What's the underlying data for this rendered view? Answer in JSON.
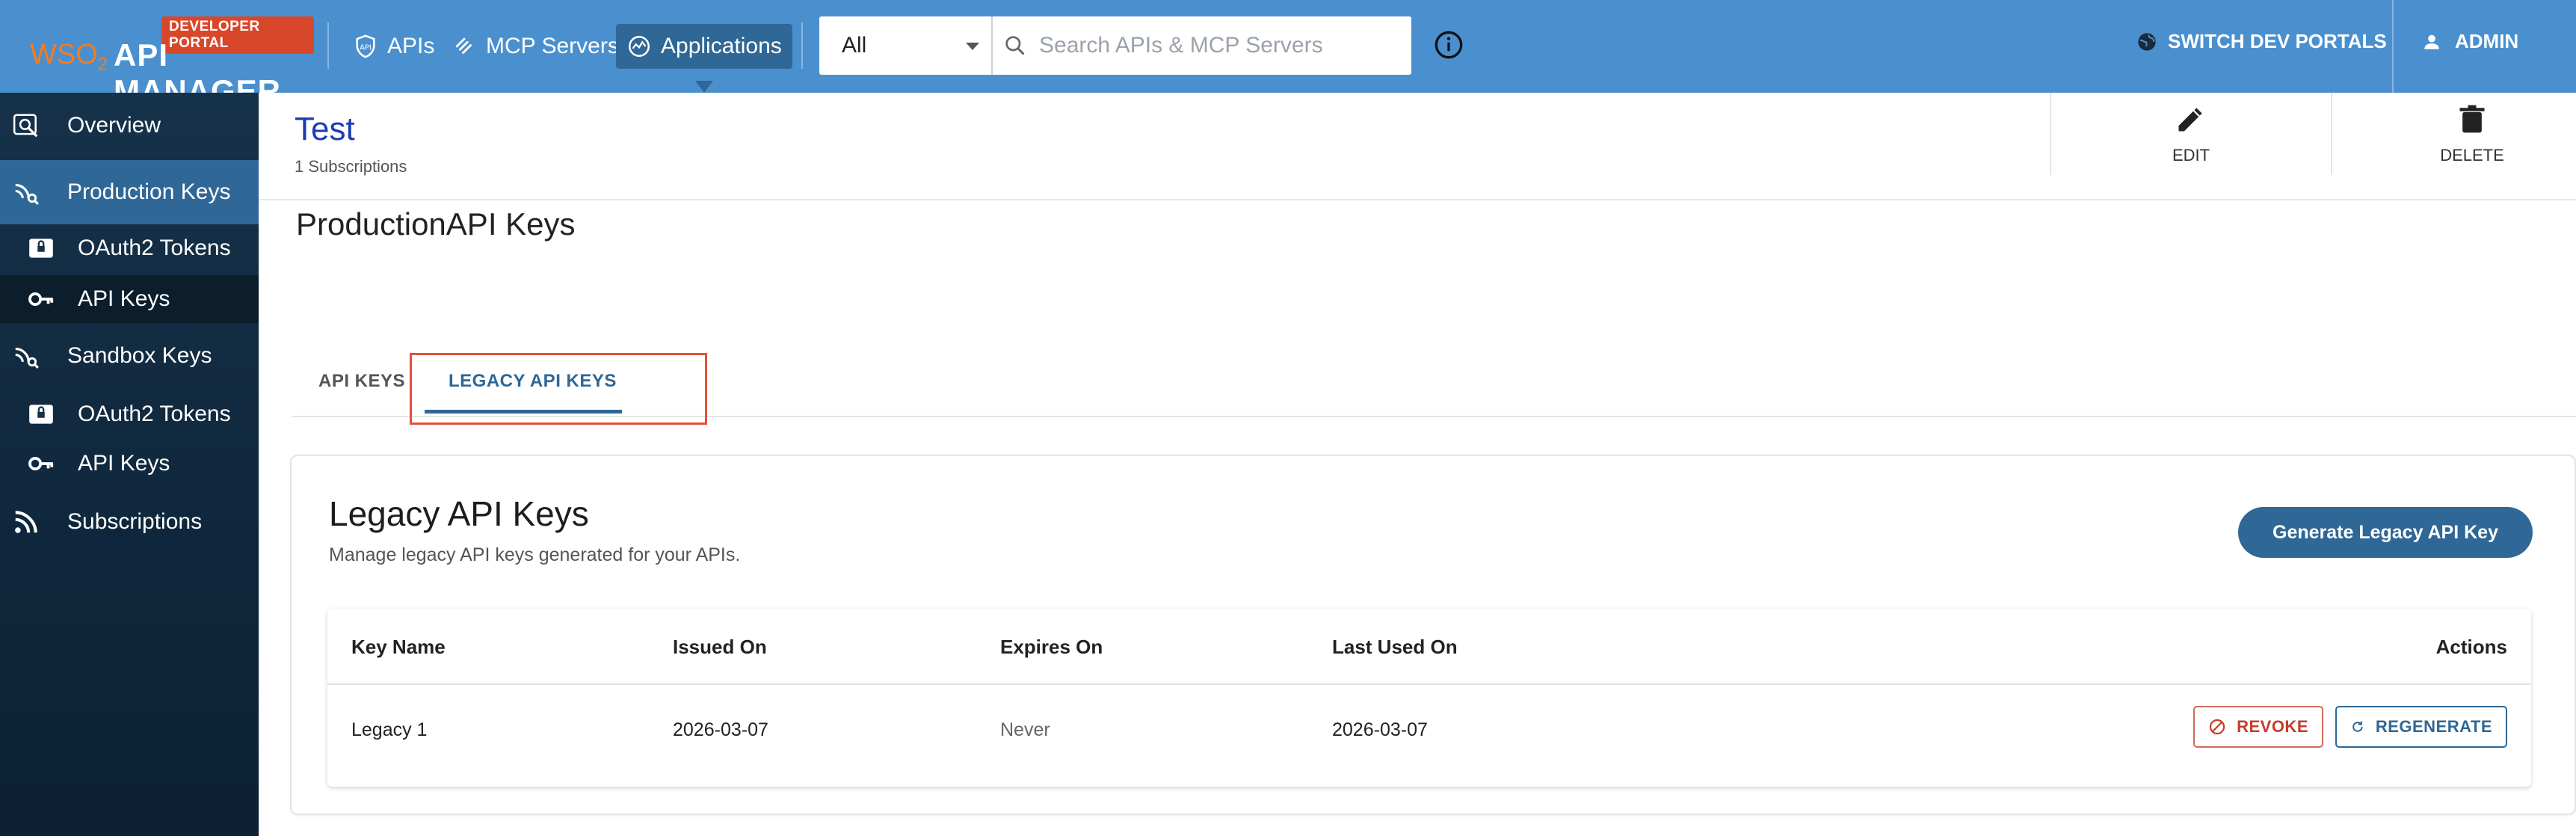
{
  "header": {
    "badge": "DEVELOPER PORTAL",
    "logo_wso": "WSO",
    "logo_2": "2",
    "logo_title": "API MANAGER",
    "nav": [
      {
        "label": "APIs",
        "icon": "api-shield-icon"
      },
      {
        "label": "MCP Servers",
        "icon": "mcp-icon"
      },
      {
        "label": "Applications",
        "icon": "applications-icon",
        "active": true
      }
    ],
    "search_scope": "All",
    "search_placeholder": "Search APIs & MCP Servers",
    "switch_label": "SWITCH DEV PORTALS",
    "user_label": "ADMIN"
  },
  "sidebar": {
    "items": [
      {
        "label": "Overview",
        "icon": "overview-search-icon"
      },
      {
        "label": "Production Keys",
        "icon": "keys-signal-icon"
      },
      {
        "label": "OAuth2 Tokens",
        "icon": "oauth-lock-icon"
      },
      {
        "label": "API Keys",
        "icon": "key-icon"
      },
      {
        "label": "Sandbox Keys",
        "icon": "keys-signal-icon"
      },
      {
        "label": "OAuth2 Tokens",
        "icon": "oauth-lock-icon"
      },
      {
        "label": "API Keys",
        "icon": "key-icon"
      },
      {
        "label": "Subscriptions",
        "icon": "rss-icon"
      }
    ]
  },
  "app": {
    "title": "Test",
    "subscriptions": "1 Subscriptions",
    "edit_label": "EDIT",
    "delete_label": "DELETE"
  },
  "section_title": "ProductionAPI Keys",
  "tabs": [
    "API KEYS",
    "LEGACY API KEYS"
  ],
  "card": {
    "title": "Legacy API Keys",
    "description": "Manage legacy API keys generated for your APIs.",
    "generate_label": "Generate Legacy API Key"
  },
  "table": {
    "headers": [
      "Key Name",
      "Issued On",
      "Expires On",
      "Last Used On",
      "Actions"
    ],
    "rows": [
      {
        "key_name": "Legacy 1",
        "issued_on": "2026-03-07",
        "expires_on": "Never",
        "last_used_on": "2026-03-07",
        "revoke": "REVOKE",
        "regenerate": "REGENERATE"
      }
    ]
  },
  "colors": {
    "topbar": "#4a90cf",
    "accent": "#2f6796",
    "sidebar": "#16324a",
    "danger": "#c63b2a",
    "badge": "#d9472b"
  }
}
